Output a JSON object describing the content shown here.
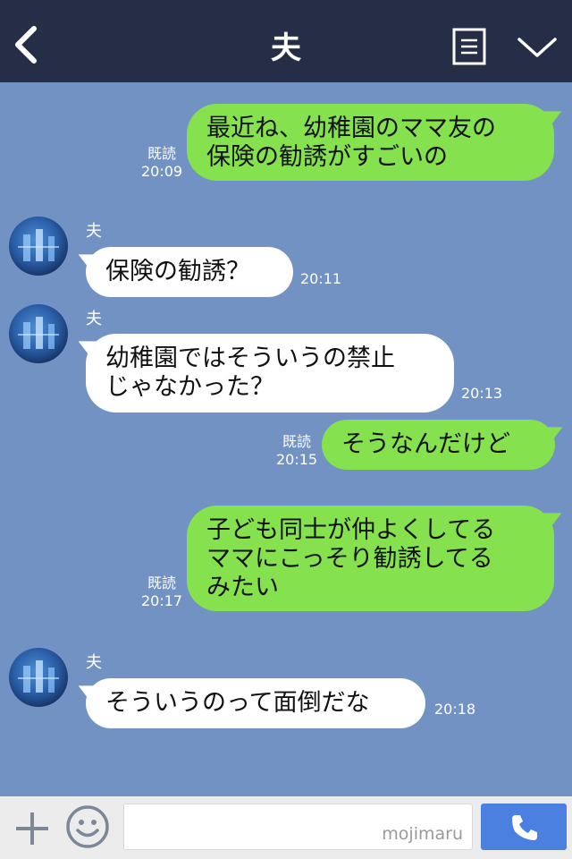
{
  "header": {
    "title": "夫",
    "back_icon": "chevron-left-icon",
    "notes_icon": "notes-icon",
    "menu_icon": "chevron-down-icon"
  },
  "messages": [
    {
      "side": "me",
      "lines": [
        "最近ね、幼稚園のママ友の",
        "保険の勧誘がすごいの"
      ],
      "read": "既読",
      "time": "20:09"
    },
    {
      "side": "them",
      "sender": "夫",
      "lines": [
        "保険の勧誘？"
      ],
      "time": "20:11"
    },
    {
      "side": "them",
      "sender": "夫",
      "lines": [
        "幼稚園ではそういうの禁止",
        "じゃなかった？"
      ],
      "time": "20:13"
    },
    {
      "side": "me",
      "lines": [
        "そうなんだけど"
      ],
      "read": "既読",
      "time": "20:15"
    },
    {
      "side": "me",
      "lines": [
        "子ども同士が仲よくしてる",
        "ママにこっそり勧誘してる",
        "みたい"
      ],
      "read": "既読",
      "time": "20:17"
    },
    {
      "side": "them",
      "sender": "夫",
      "lines": [
        "そういうのって面倒だな"
      ],
      "time": "20:18"
    }
  ],
  "composer": {
    "plus_icon": "plus-icon",
    "emoji_icon": "emoji-icon",
    "watermark": "mojimaru",
    "call_icon": "phone-icon"
  },
  "colors": {
    "header_bg": "#252e46",
    "chat_bg": "#7292c4",
    "my_bubble": "#86e14f",
    "their_bubble": "#ffffff",
    "call_button": "#4b7fe0"
  }
}
